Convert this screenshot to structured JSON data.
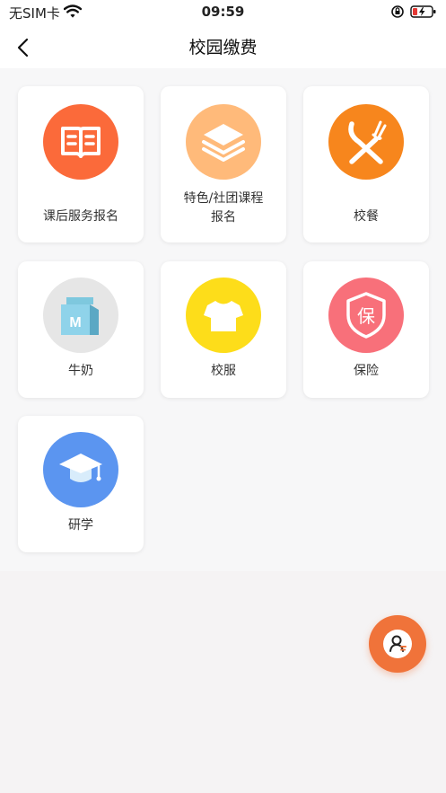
{
  "status_bar": {
    "carrier": "无SIM卡",
    "time": "09:59"
  },
  "header": {
    "title": "校园缴费"
  },
  "tiles": [
    {
      "label": "课后服务报名",
      "icon": "book-icon",
      "color": "#fb6a3a"
    },
    {
      "label": "特色/社团课程\n报名",
      "icon": "layers-icon",
      "color": "#ffba7a"
    },
    {
      "label": "校餐",
      "icon": "fork-knife-icon",
      "color": "#f7861d"
    },
    {
      "label": "牛奶",
      "icon": "milk-carton-icon",
      "color": "#e6e6e6"
    },
    {
      "label": "校服",
      "icon": "tshirt-icon",
      "color": "#fddd1a"
    },
    {
      "label": "保险",
      "icon": "insurance-shield-icon",
      "color": "#f8707a",
      "glyph": "保"
    },
    {
      "label": "研学",
      "icon": "graduation-cap-icon",
      "color": "#5b95f0"
    }
  ],
  "fab": {
    "icon": "customer-service-icon",
    "color": "#f0733a"
  }
}
